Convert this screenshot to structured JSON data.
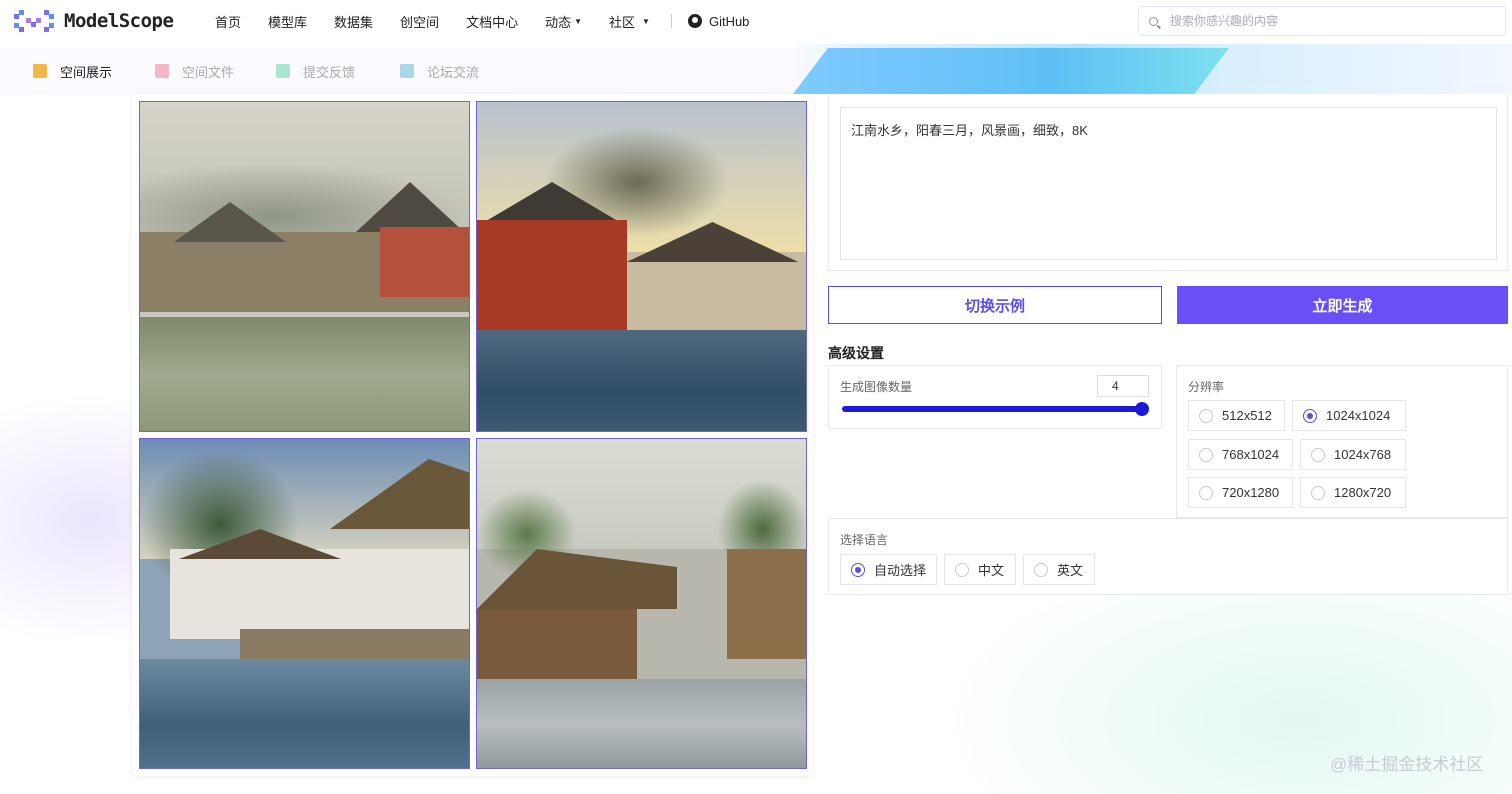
{
  "brand": {
    "name": "ModelScope"
  },
  "nav": {
    "items": [
      "首页",
      "模型库",
      "数据集",
      "创空间",
      "文档中心"
    ],
    "dropdowns": [
      "动态",
      "社区"
    ],
    "github": "GitHub"
  },
  "search": {
    "placeholder": "搜索你感兴趣的内容"
  },
  "subtabs": [
    "空间展示",
    "空间文件",
    "提交反馈",
    "论坛交流"
  ],
  "gallery": {
    "images": 4
  },
  "form": {
    "prompt_value": "江南水乡，阳春三月，风景画，细致，8K",
    "example_button": "切换示例",
    "generate_button": "立即生成",
    "advanced_title": "高级设置",
    "count_label": "生成图像数量",
    "count_value": "4",
    "count_fraction": 1.0,
    "resolution_label": "分辨率",
    "resolutions": [
      "512x512",
      "1024x1024",
      "768x1024",
      "1024x768",
      "720x1280",
      "1280x720"
    ],
    "resolution_selected": "1024x1024",
    "language_label": "选择语言",
    "languages": [
      "自动选择",
      "中文",
      "英文"
    ],
    "language_selected": "自动选择"
  },
  "watermark": "@稀土掘金技术社区",
  "colors": {
    "accent": "#6a4ff7",
    "slider": "#1a1ad6",
    "border_accent": "#5a4fe0"
  }
}
